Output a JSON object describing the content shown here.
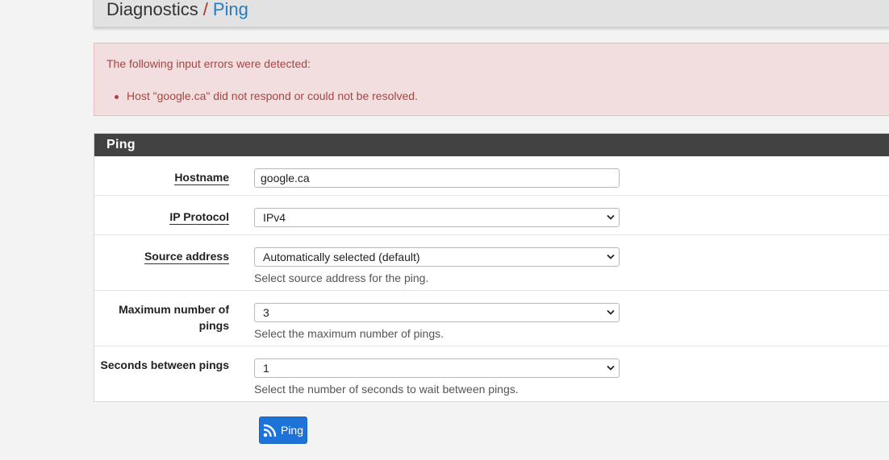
{
  "breadcrumb": {
    "parent": "Diagnostics",
    "separator": "/",
    "current": "Ping"
  },
  "alert": {
    "title": "The following input errors were detected:",
    "items": [
      "Host \"google.ca\" did not respond or could not be resolved."
    ]
  },
  "panel": {
    "title": "Ping",
    "fields": {
      "hostname": {
        "label": "Hostname",
        "value": "google.ca"
      },
      "ip_protocol": {
        "label": "IP Protocol",
        "value": "IPv4"
      },
      "source_address": {
        "label": "Source address",
        "value": "Automatically selected (default)",
        "help": "Select source address for the ping."
      },
      "max_pings": {
        "label": "Maximum number of pings",
        "value": "3",
        "help": "Select the maximum number of pings."
      },
      "seconds_between": {
        "label": "Seconds between pings",
        "value": "1",
        "help": "Select the number of seconds to wait between pings."
      }
    }
  },
  "submit": {
    "label": "Ping",
    "icon": "rss-icon"
  },
  "colors": {
    "error_text": "#a94442",
    "error_bg": "#f2dede",
    "panel_heading": "#424242",
    "button": "#1e73d8",
    "breadcrumb_current": "#2a7bc0",
    "breadcrumb_separator": "#b7312c"
  }
}
